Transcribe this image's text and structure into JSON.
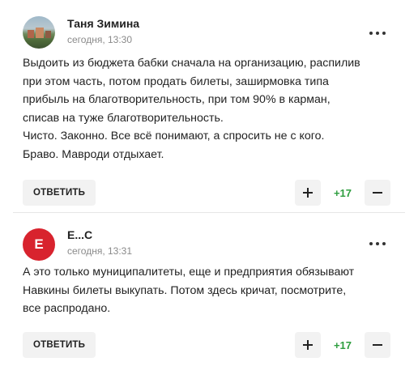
{
  "comments": [
    {
      "author": "Таня Зимина",
      "time": "сегодня, 13:30",
      "avatar_type": "photo",
      "lines": [
        "Выдоить из бюджета бабки сначала на организацию, распилив",
        "при этом часть, потом продать билеты, заширмовка типа",
        "прибыль на благотворительность, при том 90% в карман,",
        "списав на туже благотворительность.",
        "Чисто. Законно. Все всё понимают, а спросить не с кого.",
        "Браво. Мавроди отдыхает."
      ],
      "reply_label": "ОТВЕТИТЬ",
      "score": "+17"
    },
    {
      "author": "Е...С",
      "time": "сегодня, 13:31",
      "avatar_type": "letter",
      "avatar_letter": "Е",
      "avatar_color": "#d8232e",
      "lines": [
        "А это только муниципалитеты, еще и предприятия обязывают",
        "Навкины билеты выкупать. Потом здесь кричат, посмотрите,",
        "все распродано."
      ],
      "reply_label": "ОТВЕТИТЬ",
      "score": "+17"
    }
  ],
  "icons": {
    "more": "more-options-icon",
    "upvote": "plus-icon",
    "downvote": "minus-icon"
  },
  "colors": {
    "score": "#2e9e3f",
    "button_bg": "#f2f2f2",
    "timestamp": "#8a8a8a"
  }
}
